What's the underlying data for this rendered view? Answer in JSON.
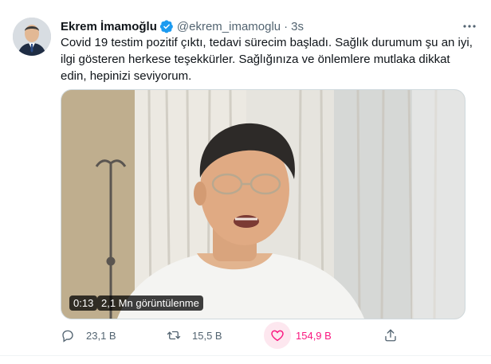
{
  "tweet": {
    "author_name": "Ekrem İmamoğlu",
    "handle": "@ekrem_imamoglu",
    "separator": "·",
    "time": "3s",
    "text": "Covid 19 testim pozitif çıktı, tedavi sürecim başladı. Sağlık durumum şu an iyi, ilgi gösteren herkese teşekkürler. Sağlığınıza ve önlemlere mutlaka dikkat edin, hepinizi seviyorum.",
    "video": {
      "duration": "0:13",
      "views": "2,1 Mn görüntülenme"
    },
    "actions": {
      "reply_count": "23,1 B",
      "retweet_count": "15,5 B",
      "like_count": "154,9 B"
    }
  },
  "icons": {
    "verified": "verified-badge-icon",
    "more": "more-dots-icon",
    "reply": "reply-icon",
    "retweet": "retweet-icon",
    "like": "heart-icon",
    "share": "share-icon"
  },
  "colors": {
    "verified": "#1d9bf0",
    "like_active": "#f91880",
    "secondary_text": "#536471"
  }
}
